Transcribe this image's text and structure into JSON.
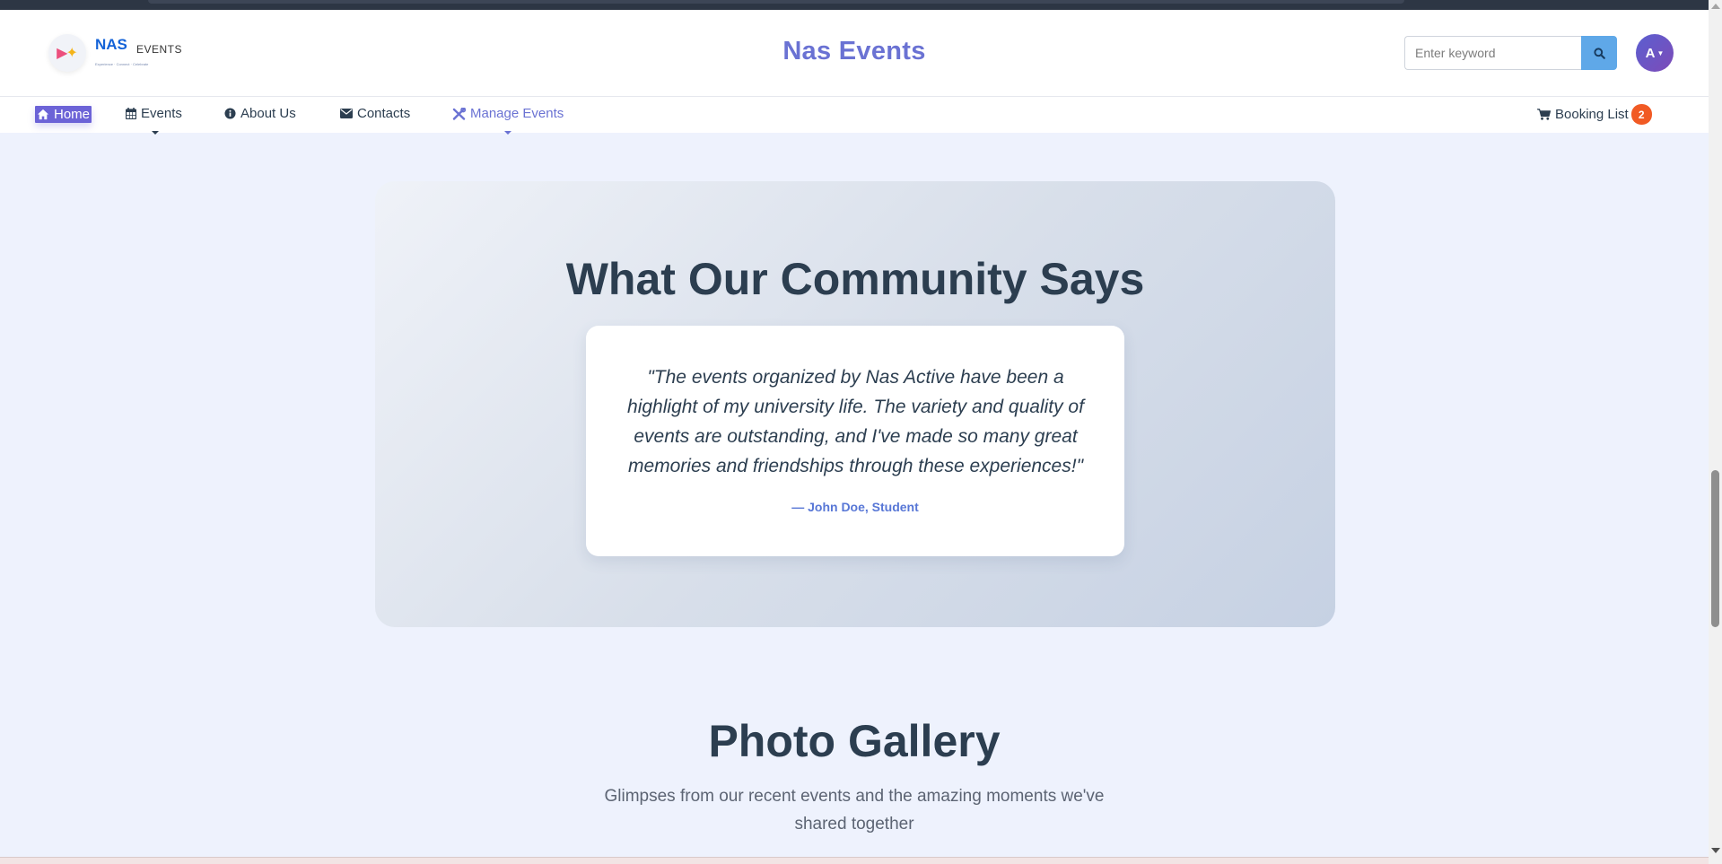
{
  "logo": {
    "brand": "NAS",
    "suffix": "EVENTS",
    "tagline": "Experience · Connect · Celebrate"
  },
  "header": {
    "site_title": "Nas Events"
  },
  "search": {
    "placeholder": "Enter keyword"
  },
  "user": {
    "avatar_initial": "A"
  },
  "nav": {
    "home": "Home",
    "events": "Events",
    "about": "About Us",
    "contacts": "Contacts",
    "manage": "Manage Events",
    "booking": "Booking List",
    "booking_count": "2"
  },
  "testimonial": {
    "heading": "What Our Community Says",
    "quote": "\"The events organized by Nas Active have been a highlight of my university life. The variety and quality of events are outstanding, and I've made so many great memories and friendships through these experiences!\"",
    "author": "— John Doe, Student"
  },
  "gallery": {
    "title": "Photo Gallery",
    "subtitle": "Glimpses from our recent events and the amazing moments we've shared together"
  },
  "colors": {
    "accent": "#6a72d3",
    "home_active": "#6c63d7",
    "badge": "#f15a24",
    "search_button": "#5fa8e8",
    "author": "#5877d6"
  }
}
